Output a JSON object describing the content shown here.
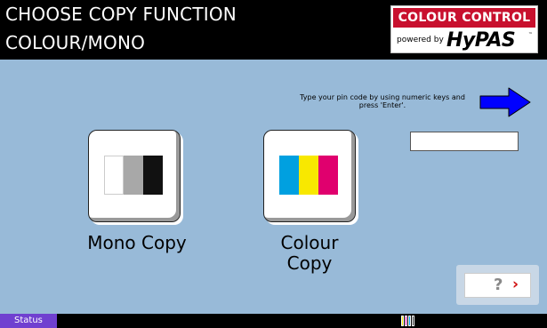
{
  "header": {
    "title_line1": "CHOOSE COPY FUNCTION",
    "title_line2": "COLOUR/MONO",
    "logo": {
      "top_text": "COLOUR CONTROL",
      "powered_by": "powered by",
      "brand": "HyPAS",
      "trademark": "™",
      "accent": "#c8102e"
    }
  },
  "pin": {
    "instruction": "Type your pin code by using numeric keys and press 'Enter'.",
    "value": "",
    "arrow_color": "#0000ff"
  },
  "functions": {
    "mono": {
      "label": "Mono Copy",
      "swatch_colors": [
        "#ffffff",
        "#a8a8a8",
        "#111111"
      ]
    },
    "colour": {
      "label": "Colour Copy",
      "swatch_colors": [
        "#00a0e0",
        "#f8e800",
        "#e0006e"
      ]
    }
  },
  "help": {
    "question": "?",
    "chevron": "›"
  },
  "status": {
    "button_label": "Status",
    "toner_colors": [
      "#ffee00",
      "#ff00aa",
      "#00aaff",
      "#222222"
    ]
  }
}
